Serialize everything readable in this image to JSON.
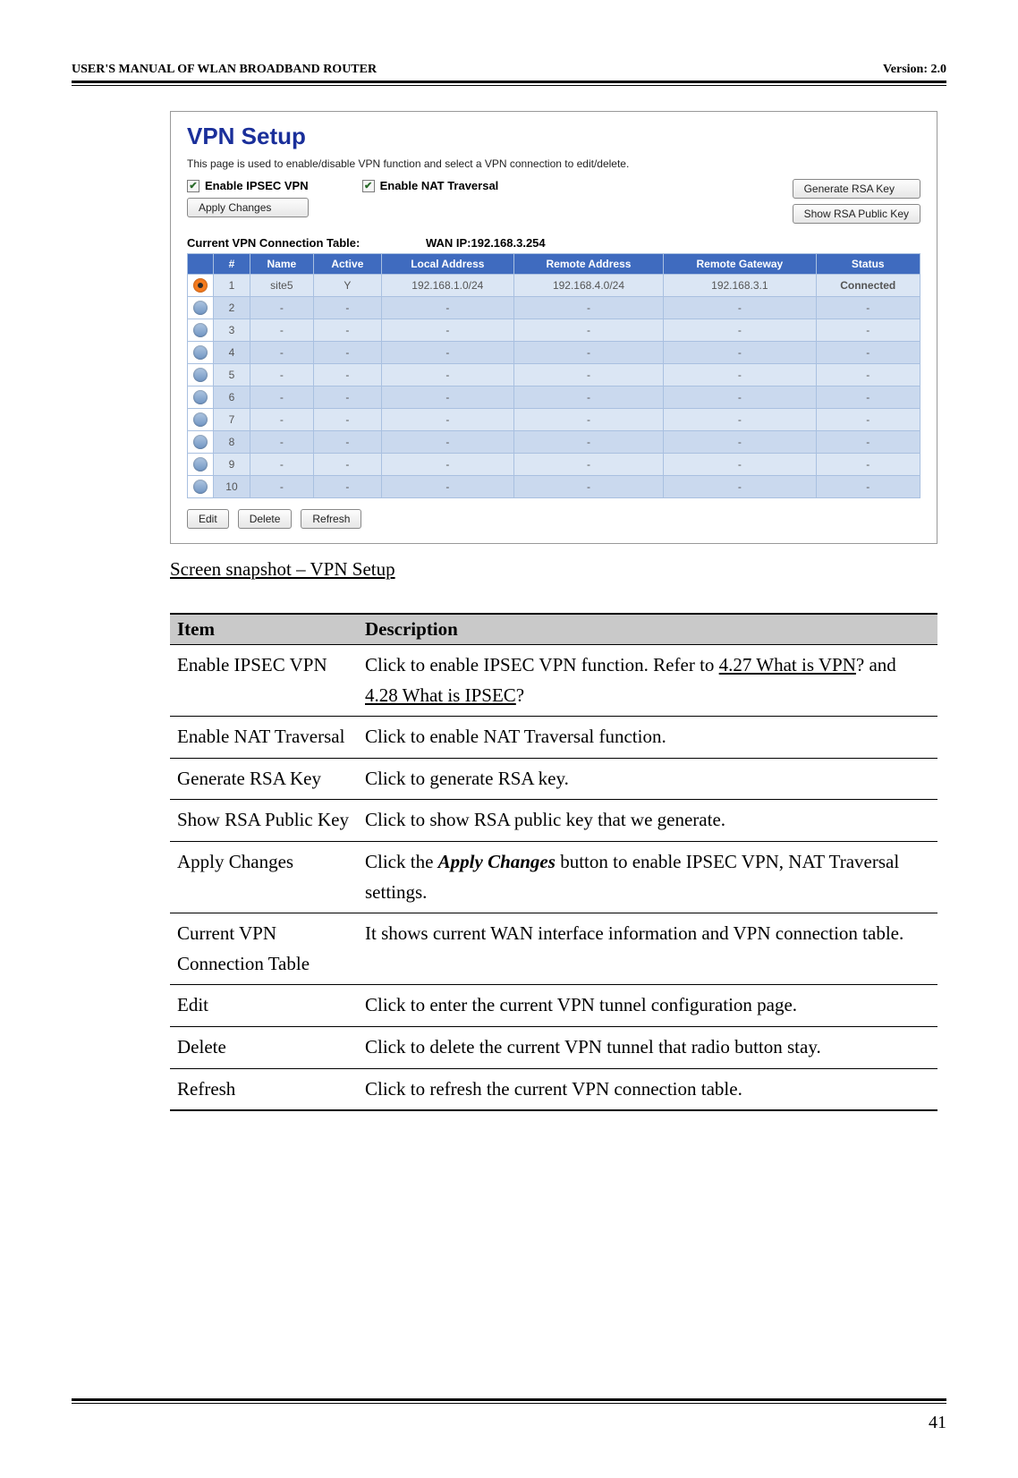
{
  "header": {
    "left": "USER'S MANUAL OF WLAN BROADBAND ROUTER",
    "right": "Version: 2.0"
  },
  "screenshot": {
    "title": "VPN Setup",
    "desc": "This page is used to enable/disable VPN function and select a VPN connection to edit/delete.",
    "enableIpsec": "Enable IPSEC VPN",
    "enableNat": "Enable NAT Traversal",
    "applyChanges": "Apply Changes",
    "generateRsa": "Generate RSA Key",
    "showRsa": "Show RSA Public Key",
    "tableLabel": "Current VPN Connection Table:",
    "wanIp": "WAN IP:192.168.3.254",
    "columns": [
      "#",
      "Name",
      "Active",
      "Local Address",
      "Remote Address",
      "Remote Gateway",
      "Status"
    ],
    "rows": [
      {
        "selected": true,
        "num": "1",
        "name": "site5",
        "active": "Y",
        "local": "192.168.1.0/24",
        "remote": "192.168.4.0/24",
        "gateway": "192.168.3.1",
        "status": "Connected",
        "statusClass": "status-connected"
      },
      {
        "selected": false,
        "num": "2",
        "name": "-",
        "active": "-",
        "local": "-",
        "remote": "-",
        "gateway": "-",
        "status": "-"
      },
      {
        "selected": false,
        "num": "3",
        "name": "-",
        "active": "-",
        "local": "-",
        "remote": "-",
        "gateway": "-",
        "status": "-"
      },
      {
        "selected": false,
        "num": "4",
        "name": "-",
        "active": "-",
        "local": "-",
        "remote": "-",
        "gateway": "-",
        "status": "-"
      },
      {
        "selected": false,
        "num": "5",
        "name": "-",
        "active": "-",
        "local": "-",
        "remote": "-",
        "gateway": "-",
        "status": "-"
      },
      {
        "selected": false,
        "num": "6",
        "name": "-",
        "active": "-",
        "local": "-",
        "remote": "-",
        "gateway": "-",
        "status": "-"
      },
      {
        "selected": false,
        "num": "7",
        "name": "-",
        "active": "-",
        "local": "-",
        "remote": "-",
        "gateway": "-",
        "status": "-"
      },
      {
        "selected": false,
        "num": "8",
        "name": "-",
        "active": "-",
        "local": "-",
        "remote": "-",
        "gateway": "-",
        "status": "-"
      },
      {
        "selected": false,
        "num": "9",
        "name": "-",
        "active": "-",
        "local": "-",
        "remote": "-",
        "gateway": "-",
        "status": "-"
      },
      {
        "selected": false,
        "num": "10",
        "name": "-",
        "active": "-",
        "local": "-",
        "remote": "-",
        "gateway": "-",
        "status": "-"
      }
    ],
    "editBtn": "Edit",
    "deleteBtn": "Delete",
    "refreshBtn": "Refresh"
  },
  "caption": "Screen snapshot – VPN Setup",
  "descTable": {
    "headItem": "Item",
    "headDesc": "Description",
    "rows": [
      {
        "item": "Enable IPSEC VPN",
        "desc_pre": "Click to enable IPSEC VPN function. Refer to ",
        "link1": "4.27 What is VPN",
        "mid": "? and ",
        "link2": "4.28 What is IPSEC",
        "suf": "?"
      },
      {
        "item": "Enable NAT Traversal",
        "desc": "Click to enable NAT Traversal function."
      },
      {
        "item": "Generate RSA Key",
        "desc": "Click to generate RSA key."
      },
      {
        "item": "Show RSA Public Key",
        "desc": "Click to show RSA public key that we generate."
      },
      {
        "item": "Apply Changes",
        "desc_pre": "Click the ",
        "emph": "Apply Changes",
        "suf": " button to enable IPSEC VPN, NAT Traversal settings."
      },
      {
        "item": "Current VPN Connection Table",
        "desc": "It shows current WAN interface information and VPN connection table."
      },
      {
        "item": "Edit",
        "desc": "Click to enter the current VPN tunnel configuration page."
      },
      {
        "item": "Delete",
        "desc": "Click to delete the current VPN tunnel that radio button stay."
      },
      {
        "item": "Refresh",
        "desc": "Click to refresh the current VPN connection table."
      }
    ]
  },
  "pageNumber": "41"
}
